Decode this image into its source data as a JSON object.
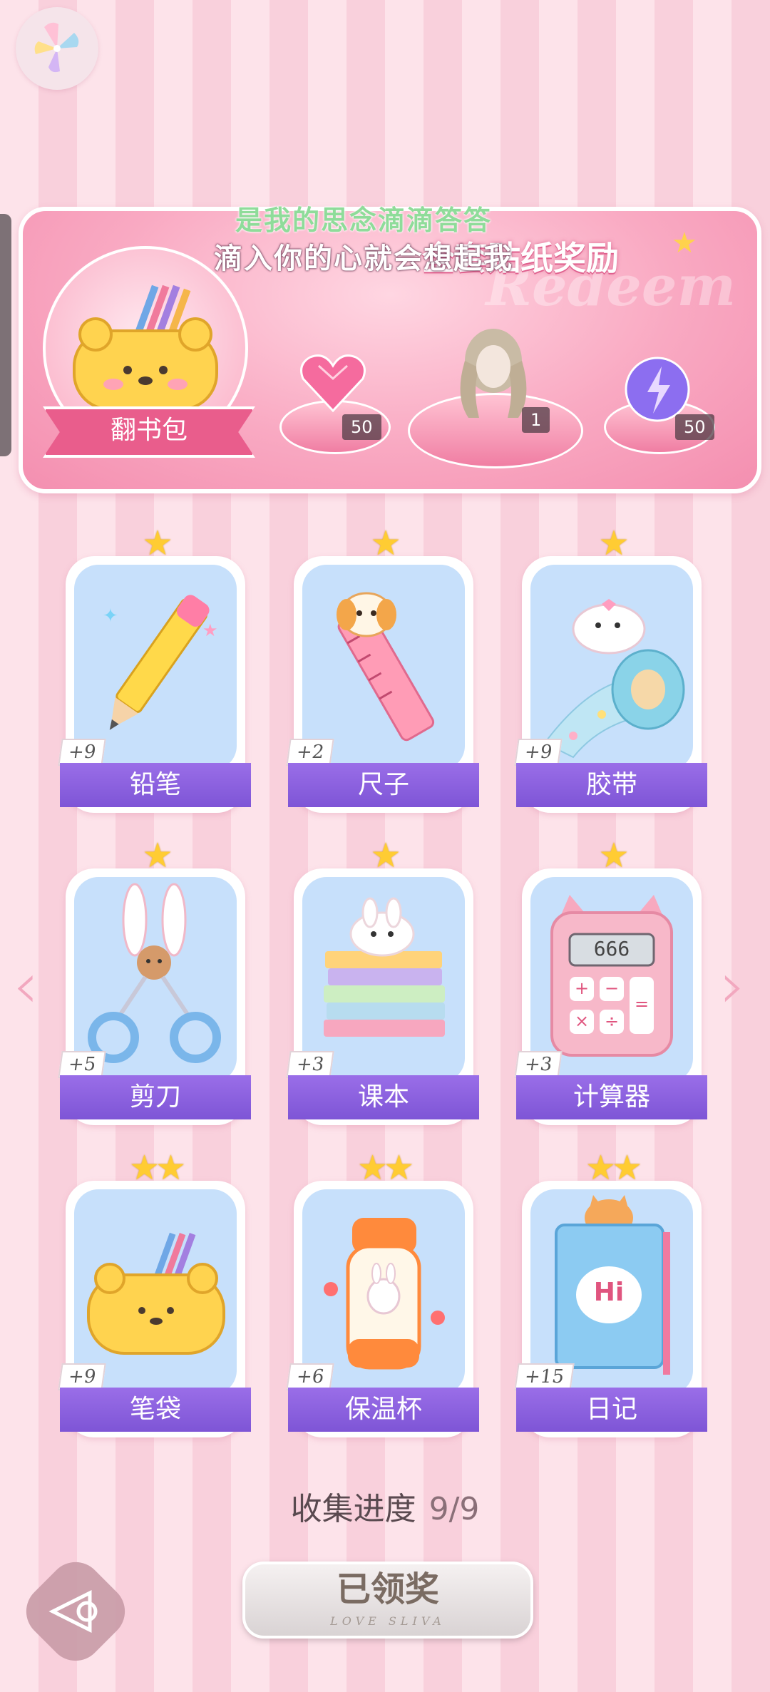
{
  "banner": {
    "title": "全套贴纸奖励",
    "watermark": "Redeem",
    "overlay_line1": "是我的思念滴滴答答",
    "overlay_line2": "滴入你的心就会想起我",
    "bag_label": "翻书包",
    "rewards": [
      {
        "icon": "heart-gem-icon",
        "count": "50"
      },
      {
        "icon": "hairstyle-icon",
        "count": "1"
      },
      {
        "icon": "energy-orb-icon",
        "count": "50"
      }
    ]
  },
  "cards": [
    {
      "label": "铅笔",
      "bonus": "+9",
      "stars": 1,
      "icon": "pencil-icon"
    },
    {
      "label": "尺子",
      "bonus": "+2",
      "stars": 1,
      "icon": "ruler-icon"
    },
    {
      "label": "胶带",
      "bonus": "+9",
      "stars": 1,
      "icon": "tape-icon"
    },
    {
      "label": "剪刀",
      "bonus": "+5",
      "stars": 1,
      "icon": "scissors-icon"
    },
    {
      "label": "课本",
      "bonus": "+3",
      "stars": 1,
      "icon": "textbook-icon"
    },
    {
      "label": "计算器",
      "bonus": "+3",
      "stars": 1,
      "icon": "calculator-icon"
    },
    {
      "label": "笔袋",
      "bonus": "+9",
      "stars": 2,
      "icon": "pencil-case-icon"
    },
    {
      "label": "保温杯",
      "bonus": "+6",
      "stars": 2,
      "icon": "thermos-icon"
    },
    {
      "label": "日记",
      "bonus": "+15",
      "stars": 2,
      "icon": "diary-icon"
    }
  ],
  "calculator_display": "666",
  "diary_text": "Hi",
  "progress": {
    "label": "收集进度",
    "value": "9/9"
  },
  "claim_button": {
    "label": "已领奖",
    "sub": "LOVE SLIVA"
  },
  "colors": {
    "accent": "#e95d8c",
    "label_purple": "#8a5fe0",
    "card_bg": "#c7e0fb"
  }
}
